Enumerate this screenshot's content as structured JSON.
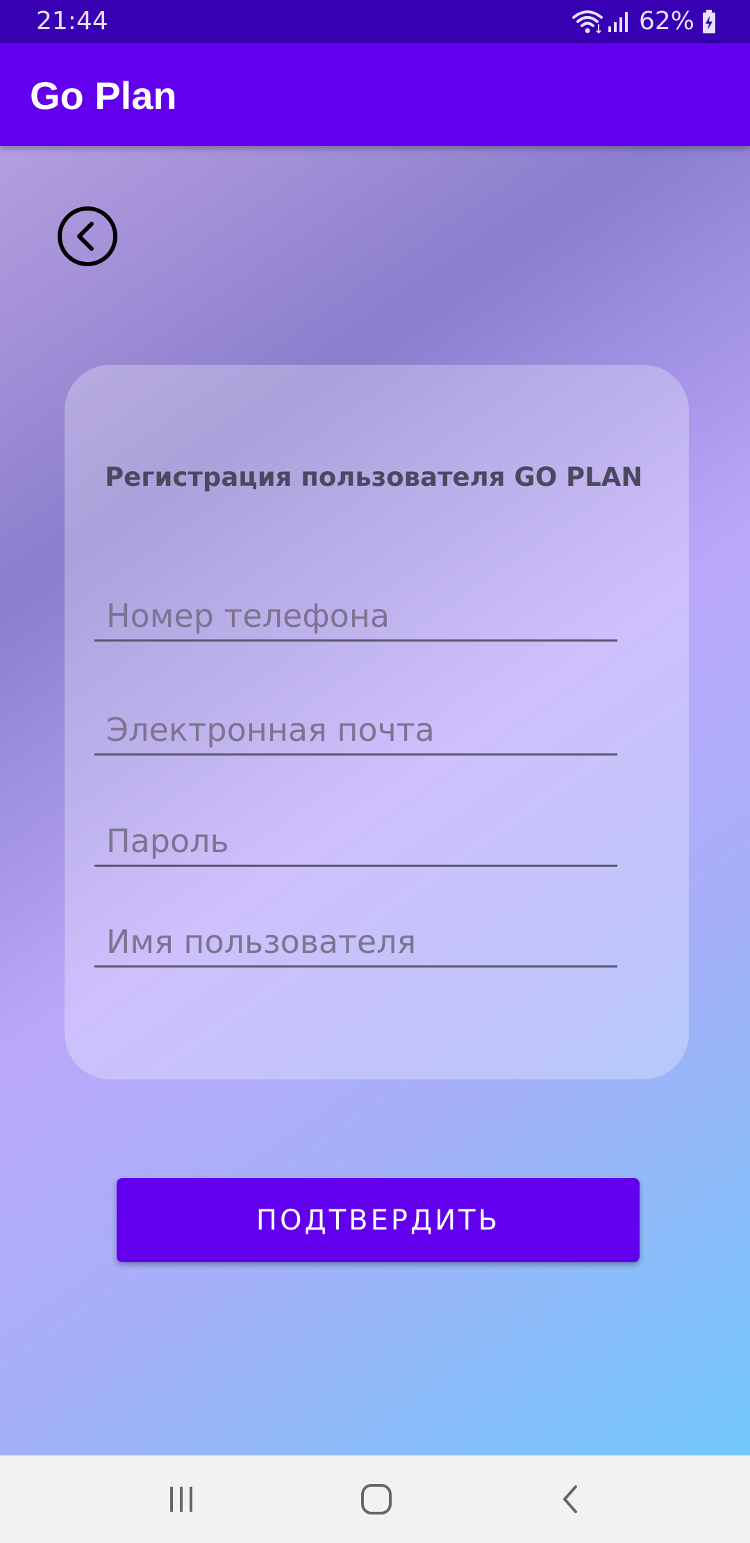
{
  "status_bar": {
    "time": "21:44",
    "battery": "62%",
    "icons": [
      "wifi-icon",
      "signal-icon",
      "battery-charging-icon"
    ]
  },
  "app_bar": {
    "title": "Go Plan"
  },
  "back_button": {
    "icon": "chevron-left-circle-icon"
  },
  "form": {
    "title": "Регистрация пользователя GO PLAN",
    "fields": [
      {
        "placeholder": "Номер телефона",
        "value": ""
      },
      {
        "placeholder": "Электронная почта",
        "value": ""
      },
      {
        "placeholder": "Пароль",
        "value": ""
      },
      {
        "placeholder": "Имя пользователя",
        "value": ""
      }
    ],
    "confirm_label": "ПОДТВЕРДИТЬ"
  },
  "nav_bar": {
    "icons": [
      "recent-apps-icon",
      "home-icon",
      "back-icon"
    ]
  },
  "colors": {
    "status_bar": "#3700b3",
    "primary": "#6200ee",
    "gradient_start": "#b59ee0",
    "gradient_end": "#73c9fb"
  }
}
